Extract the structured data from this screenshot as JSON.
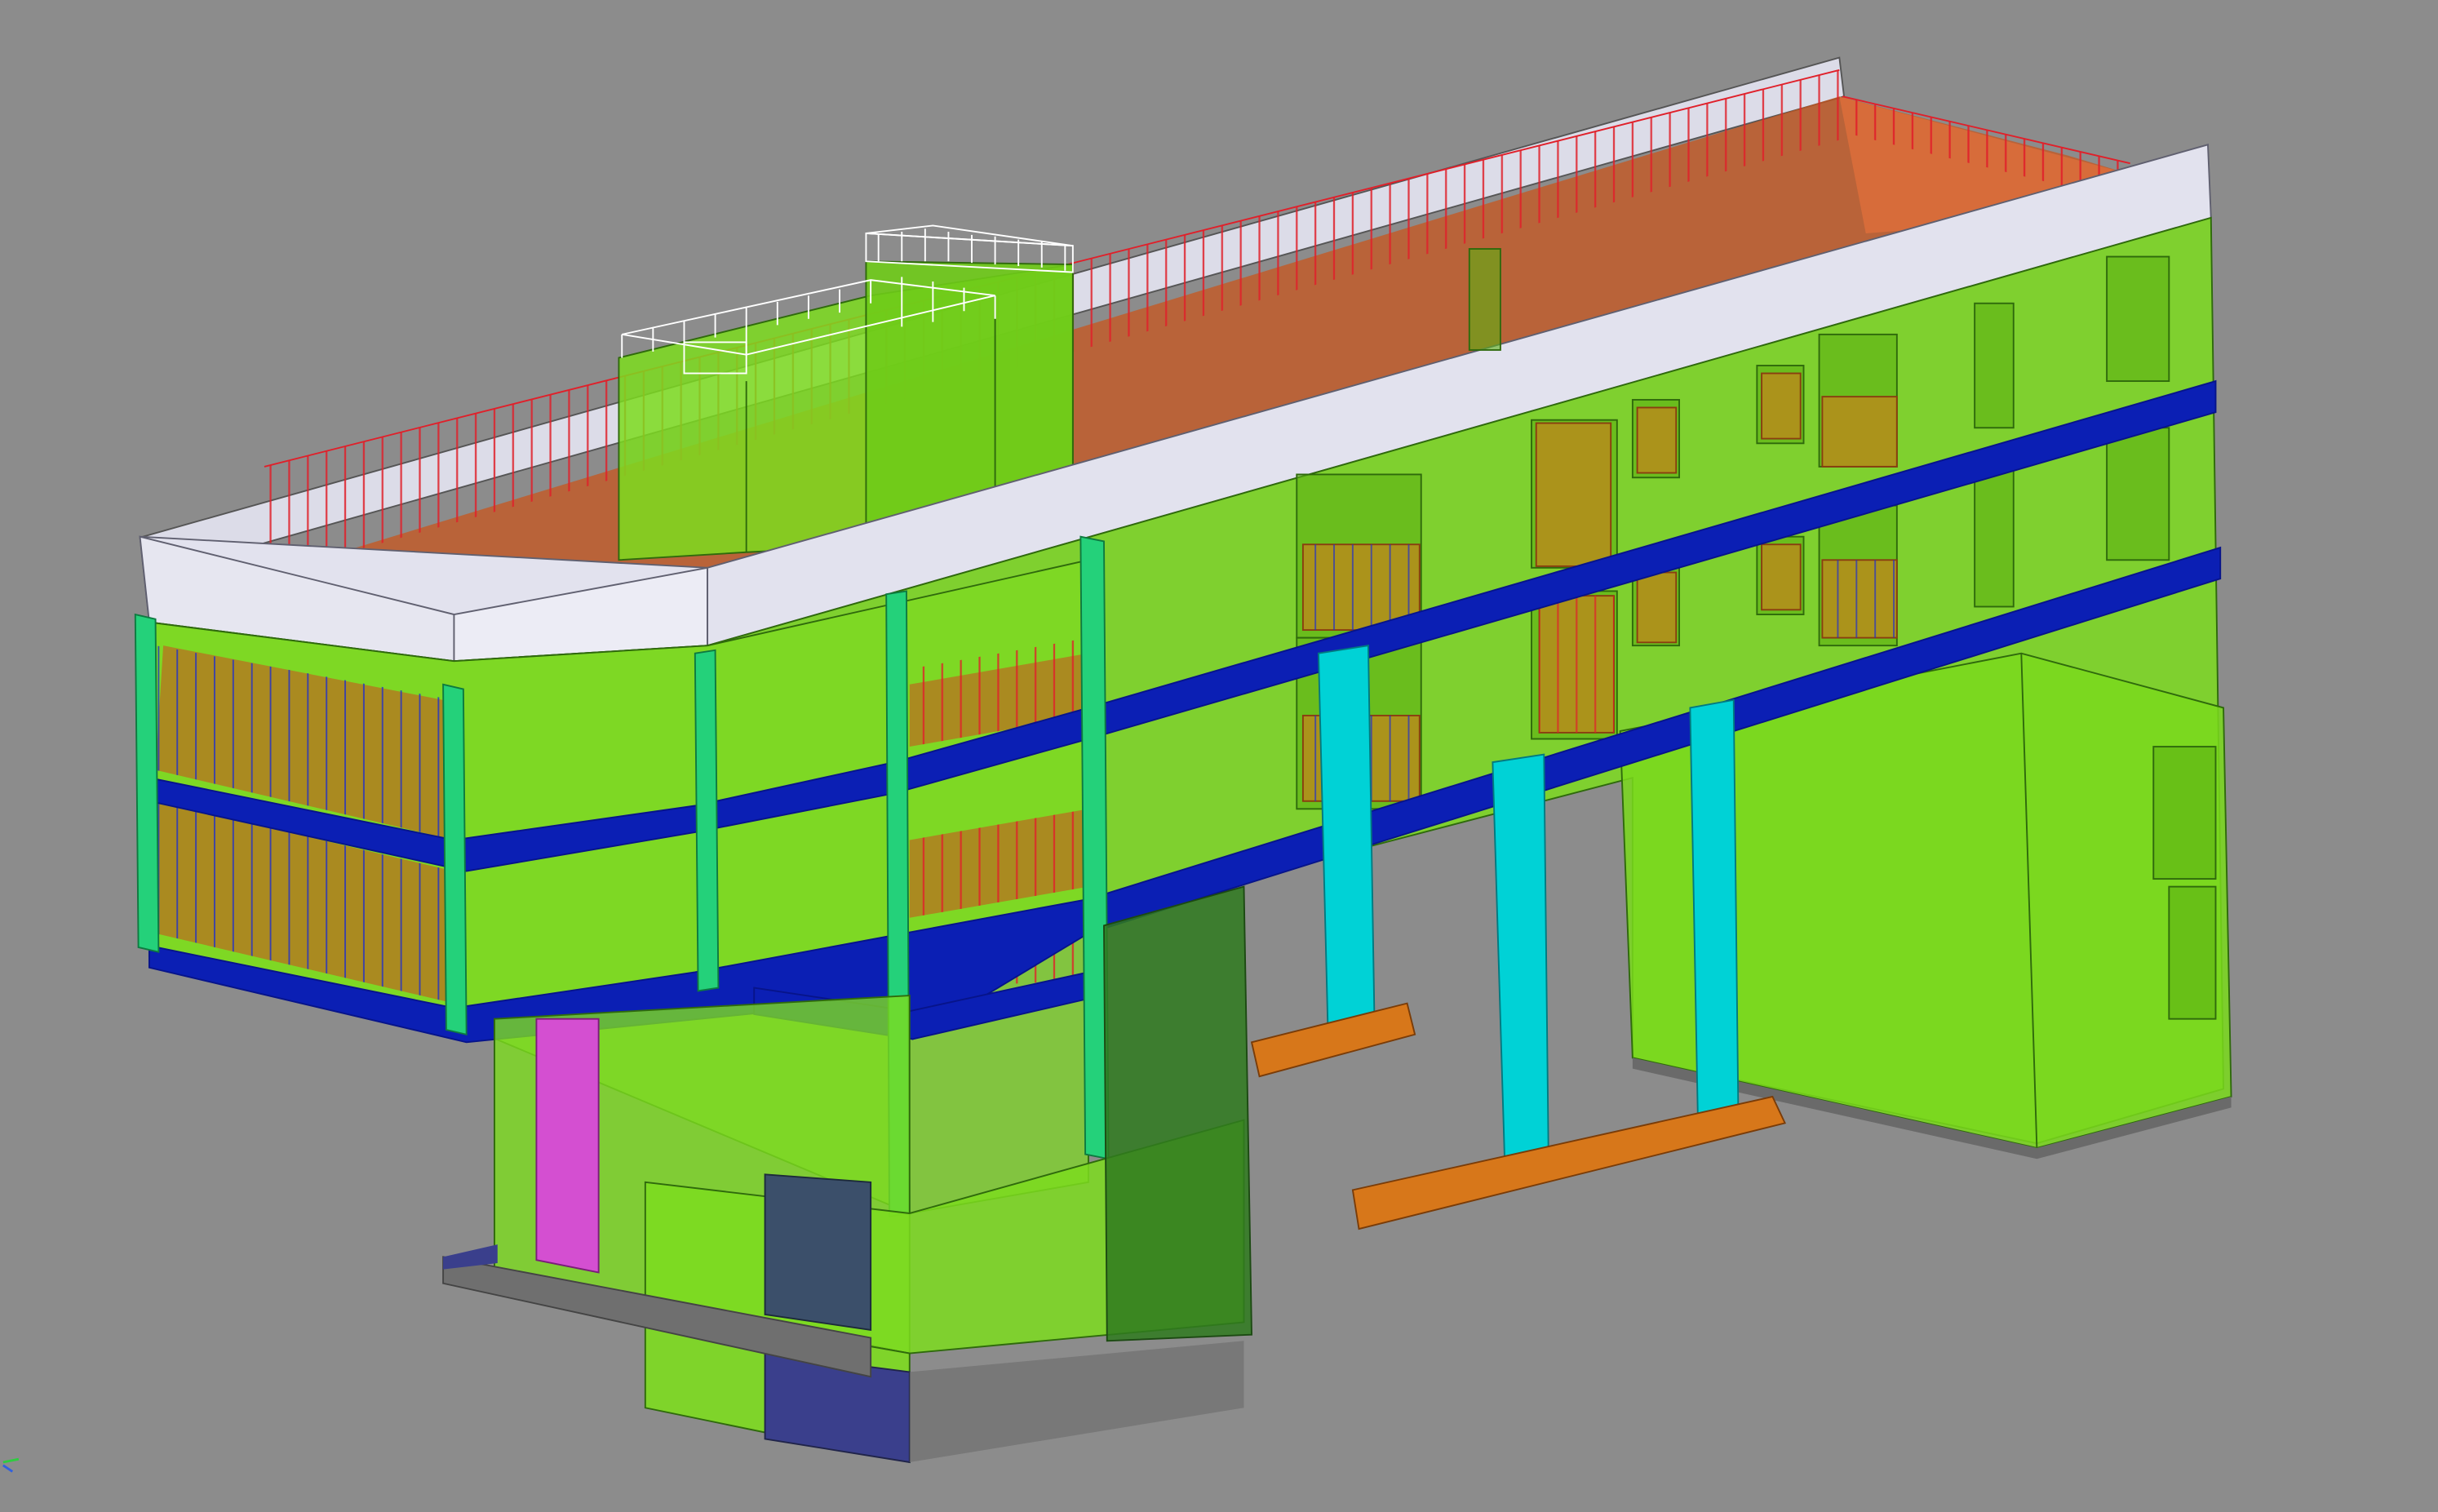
{
  "viewport": {
    "name": "3d-model-viewport",
    "background": "#8c8c8c"
  },
  "colors": {
    "wall_glass": "#7ddc1f",
    "wall_edge": "#2f6a0c",
    "slab_band": "#0b1fb4",
    "slab_band_dark": "#07148a",
    "roof_parapet": "#e2e2ee",
    "roof_parapet_edge": "#606070",
    "railing_red": "#e0202a",
    "roof_deck": "#c8561e",
    "railing_white": "#ffffff",
    "column_cyan": "#00d2d6",
    "column_green": "#24d17a",
    "footing_orange": "#d7771a",
    "door_magenta": "#d44fd1",
    "base_slab_gray": "#6f6f6f",
    "stair_dark": "#3b4f6a",
    "dark_green_block": "#2f7a1e",
    "navy_base": "#3a3f8c"
  },
  "icons": {
    "axis_indicator": "axis-gizmo-icon"
  }
}
